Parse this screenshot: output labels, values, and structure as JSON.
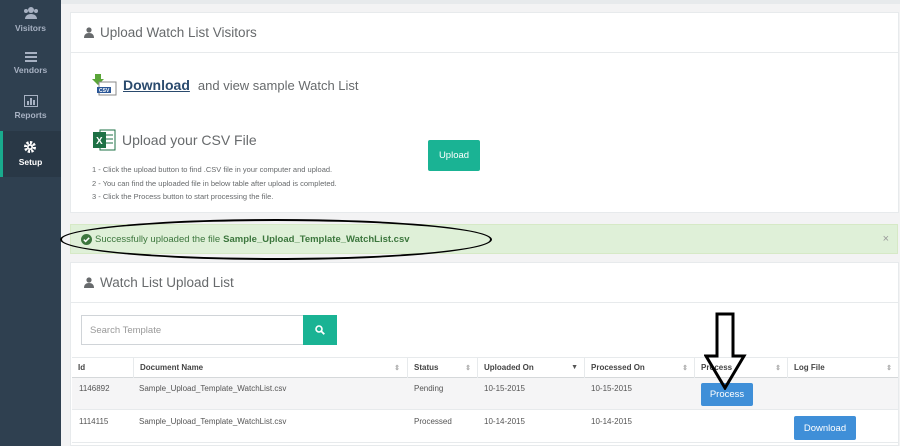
{
  "sidebar": {
    "items": [
      {
        "label": "Visitors",
        "icon": "users-icon"
      },
      {
        "label": "Vendors",
        "icon": "list-icon"
      },
      {
        "label": "Reports",
        "icon": "bar-chart-icon"
      },
      {
        "label": "Setup",
        "icon": "gear-icon",
        "active": true
      }
    ]
  },
  "upload_panel": {
    "title": "Upload Watch List Visitors",
    "download_link": "Download",
    "download_text": "and view sample Watch List",
    "upload_title": "Upload your CSV File",
    "steps": [
      "1 - Click the upload button to find .CSV file in your computer and upload.",
      "2 - You can find the uploaded file in below table after upload is completed.",
      "3 - Click the Process button to start processing the file."
    ],
    "upload_button": "Upload"
  },
  "alert": {
    "message": "Successfully uploaded the file",
    "filename": "Sample_Upload_Template_WatchList.csv",
    "close": "×"
  },
  "list_panel": {
    "title": "Watch List Upload List",
    "search_placeholder": "Search Template",
    "columns": [
      "Id",
      "Document Name",
      "Status",
      "Uploaded On",
      "Processed On",
      "Process",
      "Log File"
    ],
    "rows": [
      {
        "id": "1146892",
        "document": "Sample_Upload_Template_WatchList.csv",
        "status": "Pending",
        "uploaded": "10-15-2015",
        "processed": "10-15-2015",
        "action": "Process"
      },
      {
        "id": "1114115",
        "document": "Sample_Upload_Template_WatchList.csv",
        "status": "Processed",
        "uploaded": "10-14-2015",
        "processed": "10-14-2015",
        "action": "Download"
      }
    ]
  },
  "colors": {
    "accent": "#1ab394",
    "sidebar": "#2f4050",
    "primary_blue": "#3f8fd8",
    "success_bg": "#dff0d8"
  }
}
